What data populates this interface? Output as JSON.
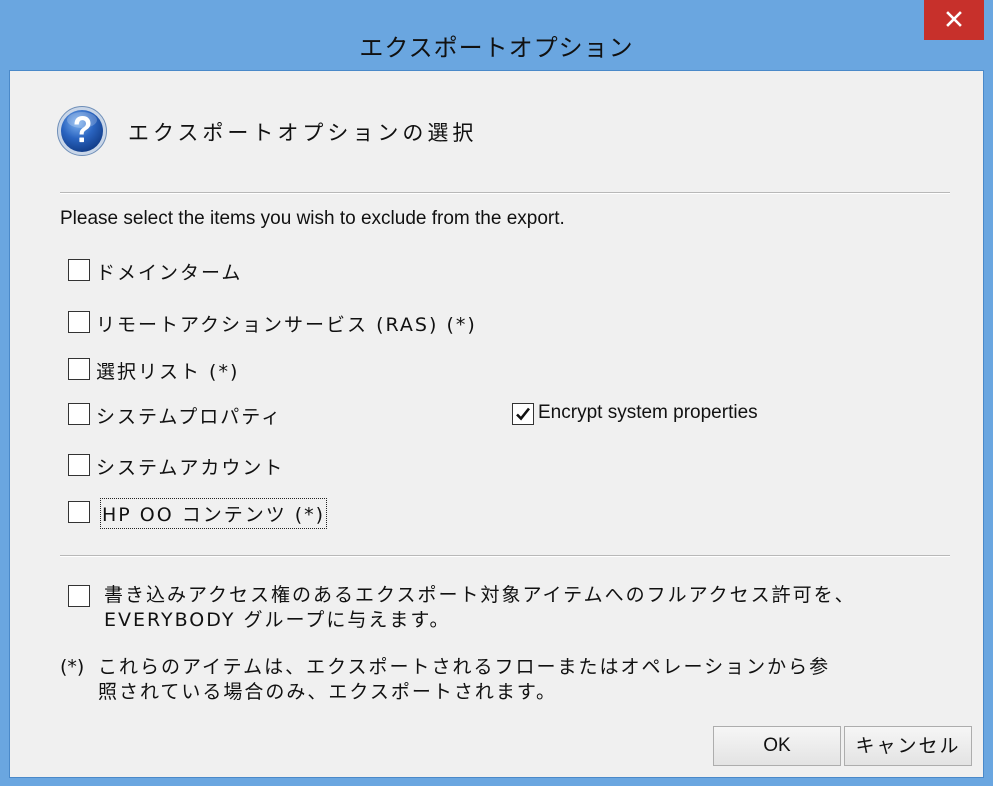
{
  "window": {
    "title": "エクスポートオプション",
    "close_icon": "close-icon"
  },
  "header": {
    "icon": "help-question-icon",
    "text": "エクスポートオプションの選択"
  },
  "instruction": "Please select the items you wish to exclude from the export.",
  "options": [
    {
      "label": "ドメインターム",
      "checked": false
    },
    {
      "label": "リモートアクションサービス (RAS) (*)",
      "checked": false
    },
    {
      "label": "選択リスト (*)",
      "checked": false
    },
    {
      "label": "システムプロパティ",
      "checked": false
    },
    {
      "label": "システムアカウント",
      "checked": false
    },
    {
      "label": "HP OO コンテンツ (*)",
      "checked": false
    }
  ],
  "encrypt": {
    "label": "Encrypt system properties",
    "checked": true
  },
  "everybody": {
    "line1": "書き込みアクセス権のあるエクスポート対象アイテムへのフルアクセス許可を、",
    "line2": "EVERYBODY グループに与えます。",
    "checked": false
  },
  "note": {
    "mark": "(*)",
    "line1": "これらのアイテムは、エクスポートされるフローまたはオペレーションから参",
    "line2": "照されている場合のみ、エクスポートされます。"
  },
  "buttons": {
    "ok": "OK",
    "cancel": "キャンセル"
  },
  "colors": {
    "titlebar": "#6aa6e0",
    "close": "#c7302b",
    "dialog_bg": "#f0f0f0"
  }
}
